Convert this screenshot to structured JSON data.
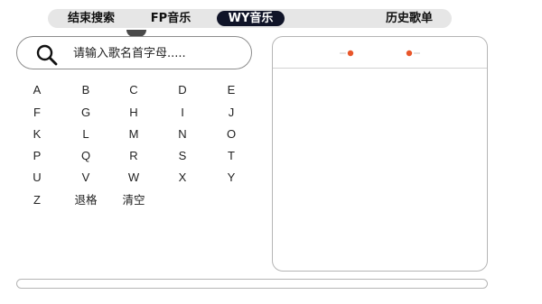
{
  "tabs": [
    {
      "label": "结束搜索"
    },
    {
      "label": "FP音乐"
    },
    {
      "label": "WY音乐",
      "active": true
    },
    {
      "label": "历史歌单"
    }
  ],
  "search": {
    "placeholder": "请输入歌名首字母....."
  },
  "keyboard": {
    "letters": [
      "A",
      "B",
      "C",
      "D",
      "E",
      "F",
      "G",
      "H",
      "I",
      "J",
      "K",
      "L",
      "M",
      "N",
      "O",
      "P",
      "Q",
      "R",
      "S",
      "T",
      "U",
      "V",
      "W",
      "X",
      "Y",
      "Z"
    ],
    "backspace_label": "退格",
    "clear_label": "清空"
  },
  "colors": {
    "active_tab": "#101428",
    "tab_bar": "#e6e6e6",
    "accent_dot": "#e8562a"
  }
}
